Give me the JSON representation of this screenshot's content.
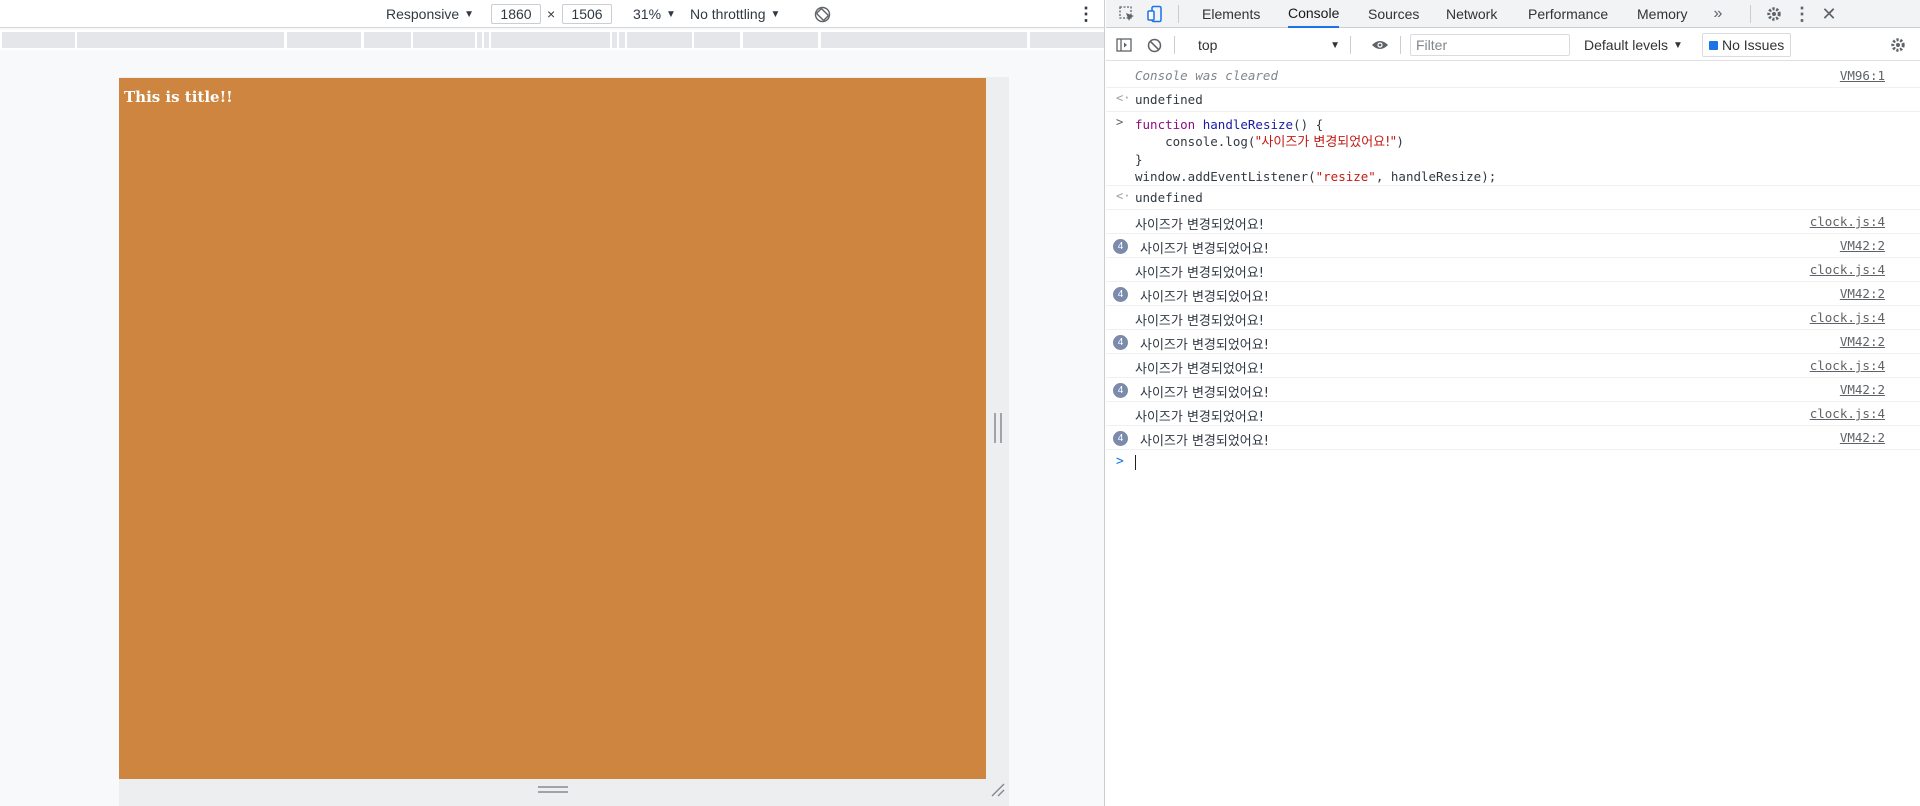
{
  "device_toolbar": {
    "device": "Responsive",
    "width": "1860",
    "times": "×",
    "height": "1506",
    "zoom": "31%",
    "throttling": "No throttling"
  },
  "page": {
    "title": "This is title!!",
    "background": "#cd853f"
  },
  "devtools_tabs": [
    "Elements",
    "Console",
    "Sources",
    "Network",
    "Performance",
    "Memory"
  ],
  "active_tab": "Console",
  "console_toolbar": {
    "context": "top",
    "filter_placeholder": "Filter",
    "levels": "Default levels",
    "issues": "No Issues"
  },
  "console": {
    "cleared": "Console was cleared",
    "cleared_src": "VM96:1",
    "undefined1": "undefined",
    "code_line1_kw": "function",
    "code_line1_fn": "handleResize",
    "code_line1_rest": "() {",
    "code_line2_pre": "    console.log(",
    "code_line2_str": "\"사이즈가 변경되었어요!\"",
    "code_line2_post": ")",
    "code_line3": "}",
    "code_line4_pre": "window.addEventListener(",
    "code_line4_str": "\"resize\"",
    "code_line4_post": ", handleResize);",
    "undefined2": "undefined",
    "entries": [
      {
        "count": "",
        "text": "사이즈가 변경되었어요!",
        "src": "clock.js:4"
      },
      {
        "count": "4",
        "text": "사이즈가 변경되었어요!",
        "src": "VM42:2"
      },
      {
        "count": "",
        "text": "사이즈가 변경되었어요!",
        "src": "clock.js:4"
      },
      {
        "count": "4",
        "text": "사이즈가 변경되었어요!",
        "src": "VM42:2"
      },
      {
        "count": "",
        "text": "사이즈가 변경되었어요!",
        "src": "clock.js:4"
      },
      {
        "count": "4",
        "text": "사이즈가 변경되었어요!",
        "src": "VM42:2"
      },
      {
        "count": "",
        "text": "사이즈가 변경되었어요!",
        "src": "clock.js:4"
      },
      {
        "count": "4",
        "text": "사이즈가 변경되었어요!",
        "src": "VM42:2"
      },
      {
        "count": "",
        "text": "사이즈가 변경되었어요!",
        "src": "clock.js:4"
      },
      {
        "count": "4",
        "text": "사이즈가 변경되었어요!",
        "src": "VM42:2"
      }
    ]
  }
}
